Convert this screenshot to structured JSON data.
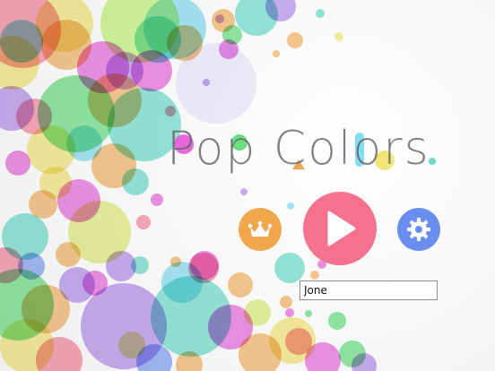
{
  "title": "Pop Colors",
  "colors": {
    "pink": "#f4728d",
    "orange": "#f0a64a",
    "blue": "#6a8ef0",
    "green": "#4ed86b",
    "yellow": "#f0e060",
    "teal": "#53d6c4",
    "purple": "#a77be8",
    "magenta": "#e34fd6"
  },
  "buttons": {
    "crown_icon": "crown-icon",
    "play_icon": "play-icon",
    "settings_icon": "gear-icon"
  },
  "name_field": {
    "value": "Jone",
    "placeholder": ""
  }
}
